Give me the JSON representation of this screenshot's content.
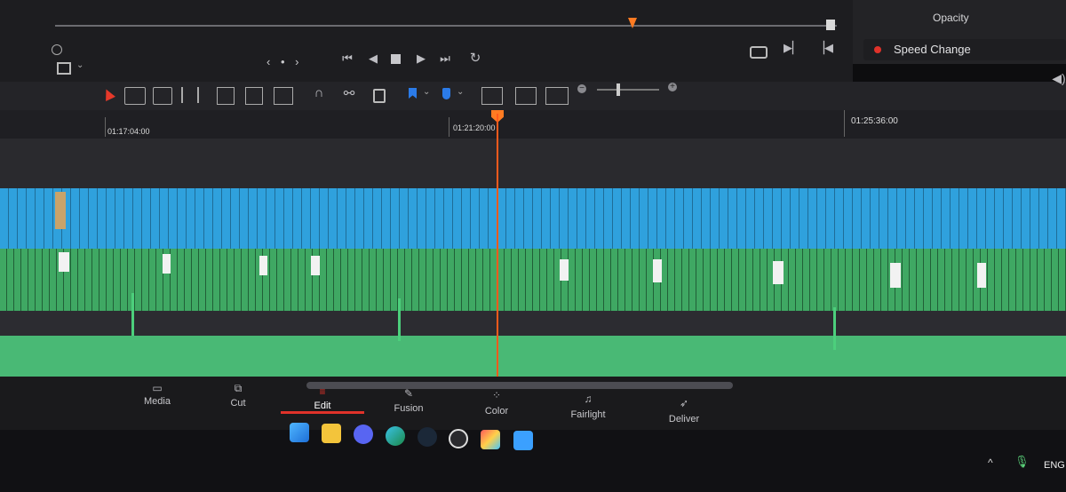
{
  "inspector": {
    "opacity_label": "Opacity",
    "speed_change_label": "Speed Change"
  },
  "viewer": {
    "nav_dots": "‹ • ›"
  },
  "ruler": {
    "timecodes": [
      "01:17:04:00",
      "01:21:20:00",
      "01:25:36:00"
    ]
  },
  "pages": [
    {
      "label": "Media",
      "icon": "media-icon"
    },
    {
      "label": "Cut",
      "icon": "cut-icon"
    },
    {
      "label": "Edit",
      "icon": "edit-icon",
      "active": true
    },
    {
      "label": "Fusion",
      "icon": "fusion-icon"
    },
    {
      "label": "Color",
      "icon": "color-icon"
    },
    {
      "label": "Fairlight",
      "icon": "fairlight-icon"
    },
    {
      "label": "Deliver",
      "icon": "deliver-icon"
    }
  ],
  "taskbar": {
    "language": "ENG"
  },
  "colors": {
    "video_track": "#2fa1dd",
    "audio_track": "#3fa863",
    "playhead": "#ff5a1c",
    "accent": "#e0322a"
  }
}
